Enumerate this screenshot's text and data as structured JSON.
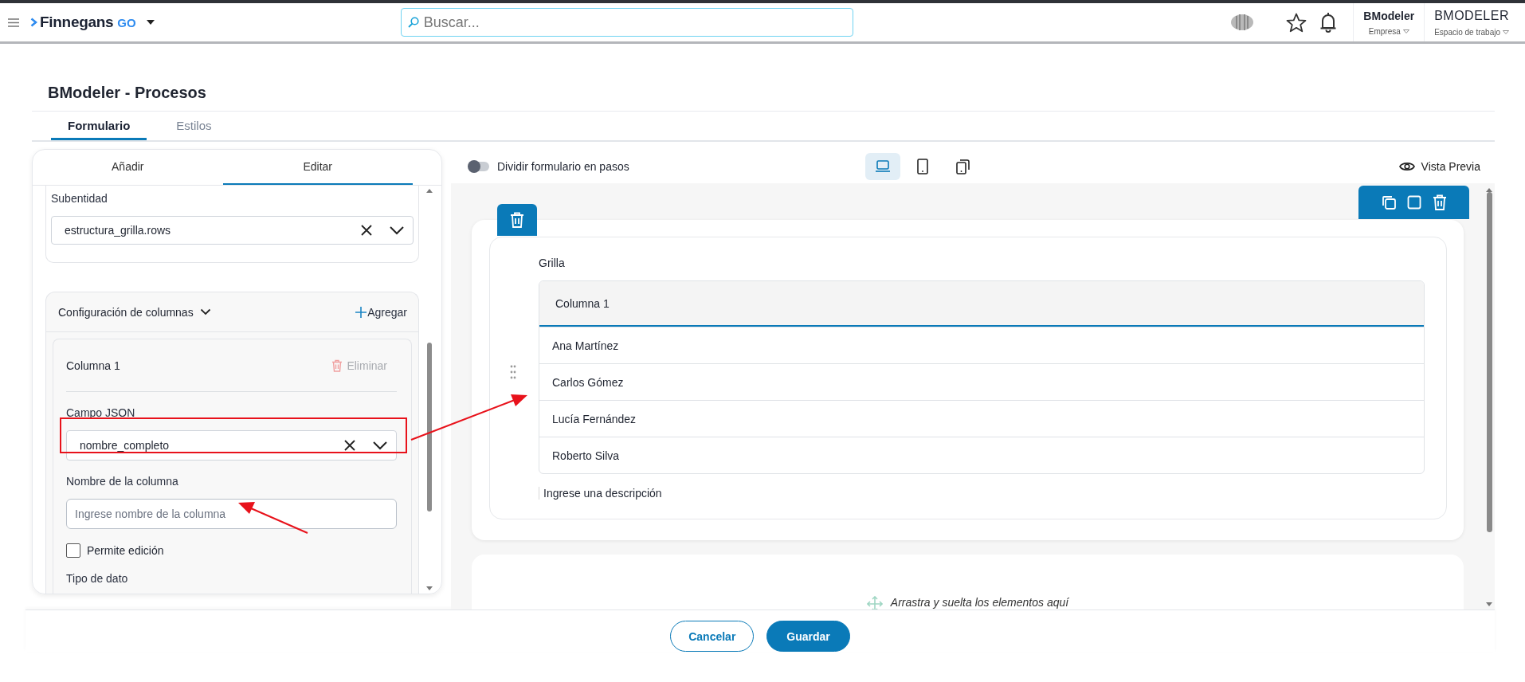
{
  "app_bar": {
    "brand": "Finnegans",
    "brand_suffix": "GO",
    "search": {
      "placeholder": "Buscar..."
    },
    "company": {
      "name": "BModeler",
      "label": "Empresa"
    },
    "workspace": {
      "name": "BMODELER",
      "label": "Espacio de trabajo"
    }
  },
  "page": {
    "title": "BModeler - Procesos"
  },
  "tabs": [
    {
      "label": "Formulario",
      "selected": true
    },
    {
      "label": "Estilos",
      "selected": false
    }
  ],
  "editor_panel": {
    "tabs": [
      {
        "label": "Añadir",
        "selected": false
      },
      {
        "label": "Editar",
        "selected": true
      }
    ],
    "subentity": {
      "label": "Subentidad",
      "value": "estructura_grilla.rows"
    },
    "columns_config": {
      "title": "Configuración de columnas",
      "expanded": true,
      "add_label": "Agregar",
      "columns": [
        {
          "title": "Columna 1",
          "delete_label": "Eliminar",
          "delete_disabled": true,
          "json_field": {
            "label": "Campo JSON",
            "value": "nombre_completo"
          },
          "name_field": {
            "label": "Nombre de la columna",
            "placeholder": "Ingrese nombre de la columna"
          },
          "editable": {
            "label": "Permite edición",
            "checked": false
          },
          "data_type": {
            "label": "Tipo de dato"
          }
        }
      ]
    }
  },
  "toolbar": {
    "split_steps": {
      "label": "Dividir formulario en pasos",
      "on": false
    },
    "devices": [
      {
        "kind": "desktop",
        "selected": true
      },
      {
        "kind": "tablet",
        "selected": false
      },
      {
        "kind": "mobile",
        "selected": false
      }
    ],
    "preview_label": "Vista Previa"
  },
  "canvas": {
    "grid": {
      "label": "Grilla",
      "columns": [
        "Columna 1"
      ],
      "rows": [
        [
          "Ana Martínez"
        ],
        [
          "Carlos Gómez"
        ],
        [
          "Lucía Fernández"
        ],
        [
          "Roberto Silva"
        ]
      ],
      "description": "Ingrese una descripción"
    },
    "drop_zone": "Arrastra y suelta los elementos aquí"
  },
  "actions": [
    {
      "label": "Cancelar",
      "kind": "secondary"
    },
    {
      "label": "Guardar",
      "kind": "primary"
    }
  ]
}
